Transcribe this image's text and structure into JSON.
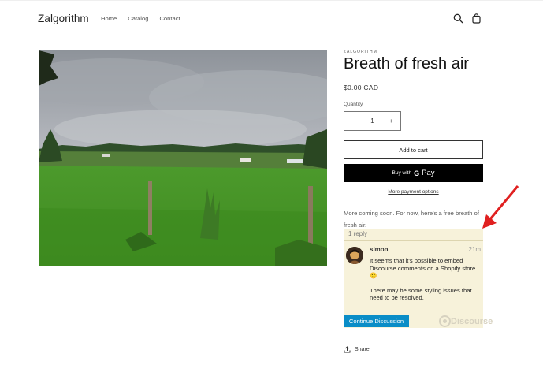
{
  "header": {
    "brand": "Zalgorithm",
    "nav": [
      "Home",
      "Catalog",
      "Contact"
    ],
    "icons": [
      "search-icon",
      "cart-icon"
    ]
  },
  "product": {
    "vendor": "ZALGORITHM",
    "title": "Breath of fresh air",
    "price": "$0.00 CAD",
    "quantity_label": "Quantity",
    "quantity_value": "1",
    "minus": "−",
    "plus": "+",
    "add_to_cart": "Add to cart",
    "gpay_prefix": "Buy with",
    "gpay_g": "G",
    "gpay_word": "Pay",
    "more_payment": "More payment options",
    "description": "More coming soon. For now, here's a free breath of fresh air.",
    "share": "Share"
  },
  "discourse": {
    "reply_count": "1 reply",
    "username": "simon",
    "time": "21m",
    "post_line1": "It seems that it's possible to embed Discourse comments on a Shopify store 🙂",
    "post_line2": "There may be some styling issues that need to be resolved.",
    "continue_button": "Continue Discussion",
    "logo_text": "Discourse"
  },
  "colors": {
    "embed_bg": "#f7f2da",
    "continue_bg": "#0a8dc7",
    "arrow": "#e02020"
  }
}
